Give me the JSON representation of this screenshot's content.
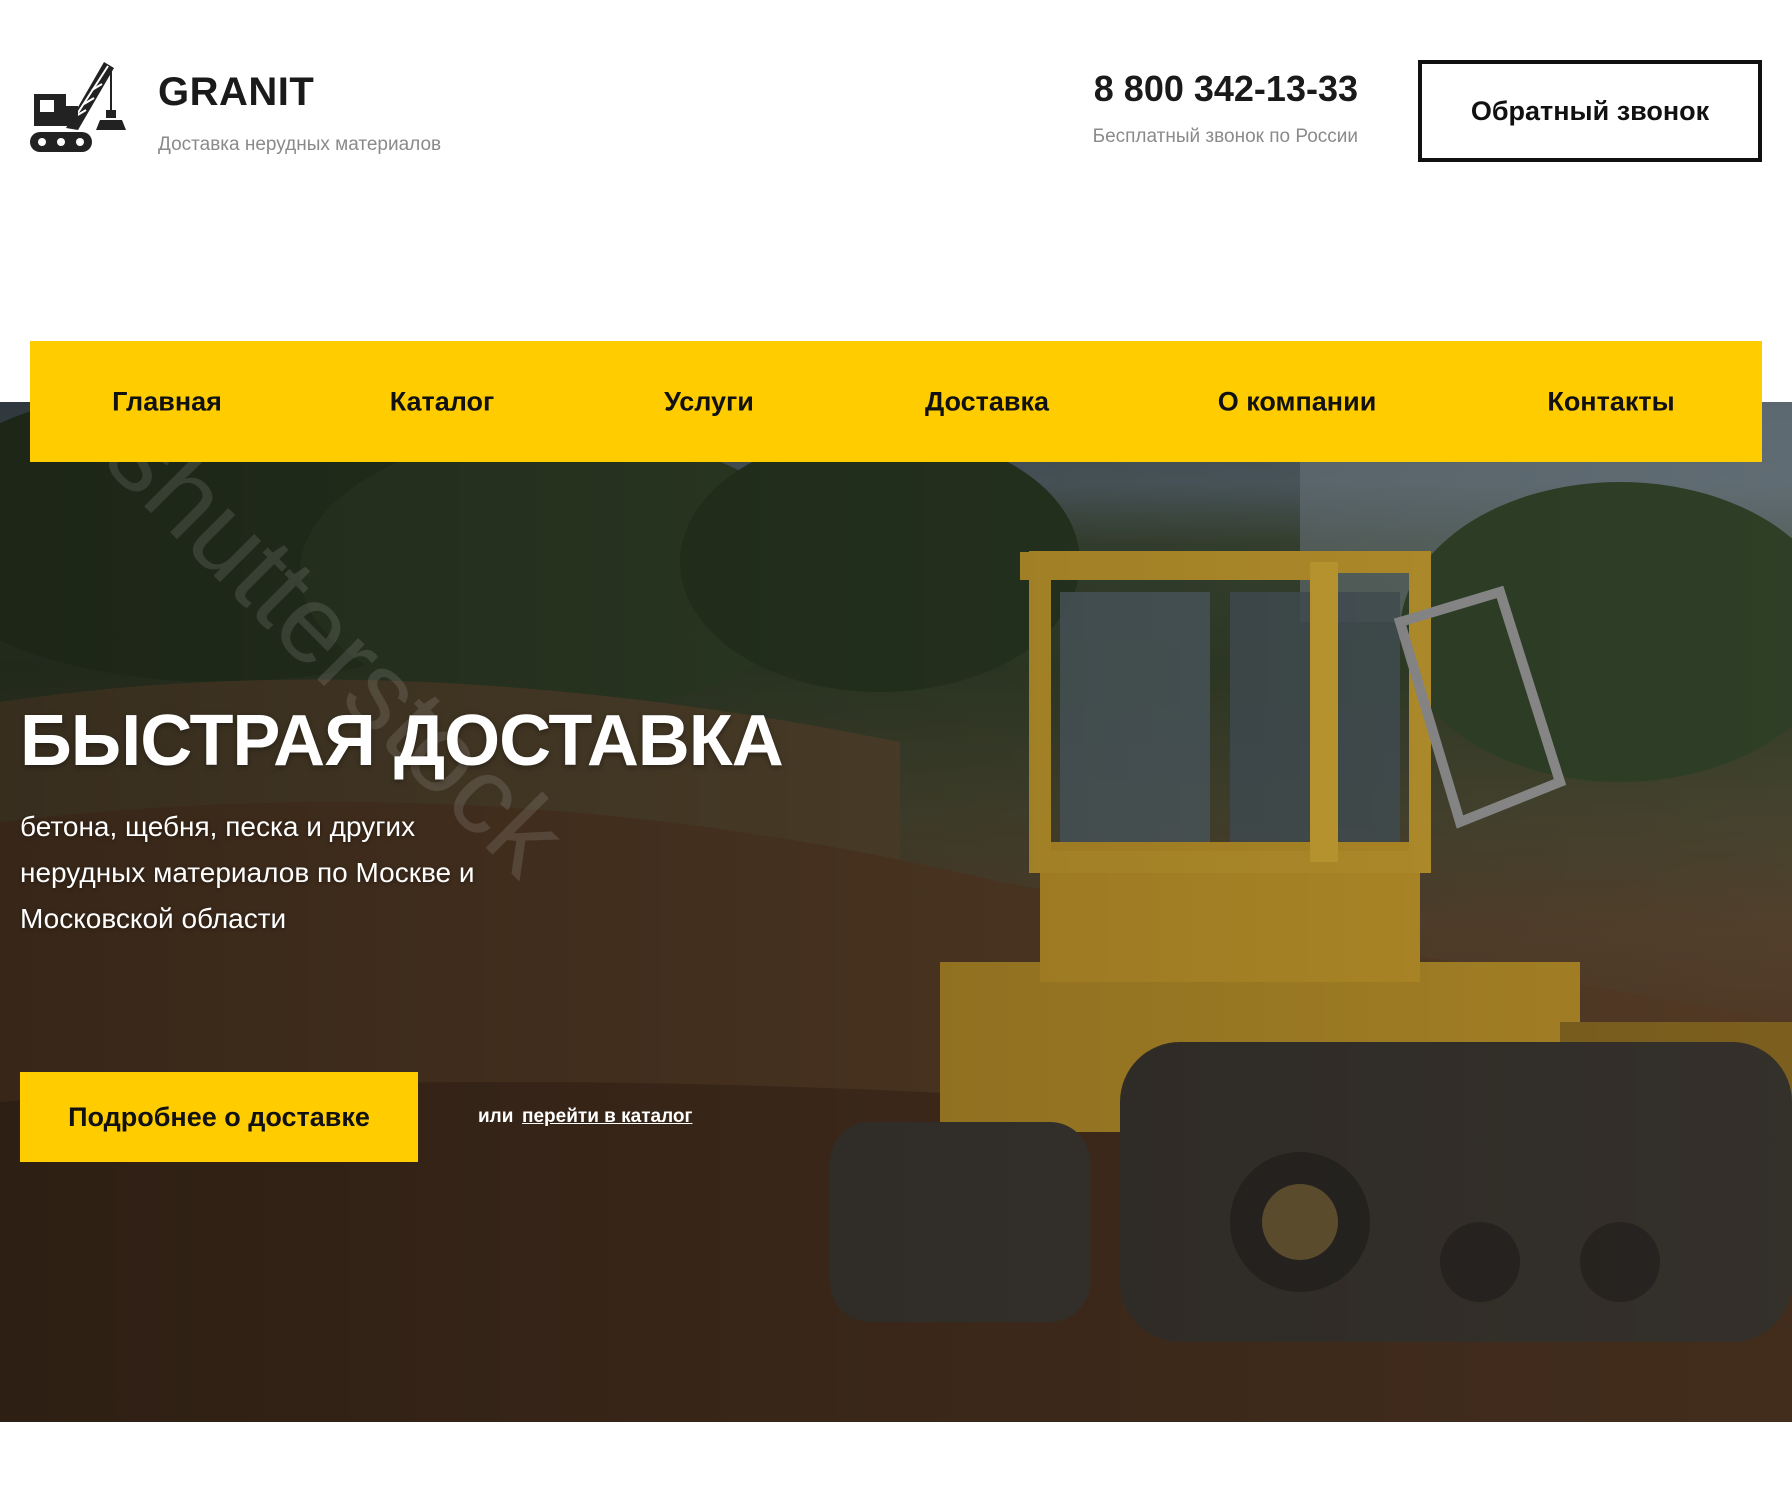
{
  "brand": {
    "name": "GRANIT",
    "tagline": "Доставка нерудных материалов",
    "logo_icon": "crawler-crane-icon"
  },
  "contact": {
    "phone": "8 800 342-13-33",
    "phone_note": "Бесплатный звонок по России",
    "callback_label": "Обратный звонок"
  },
  "nav": {
    "items": [
      {
        "label": "Главная"
      },
      {
        "label": "Каталог"
      },
      {
        "label": "Услуги"
      },
      {
        "label": "Доставка"
      },
      {
        "label": "О компании"
      },
      {
        "label": "Контакты"
      }
    ]
  },
  "hero": {
    "title": "БЫСТРАЯ ДОСТАВКА",
    "subtitle": "бетона, щебня, песка и других нерудных материалов по Москве и Московской области",
    "cta_label": "Подробнее о доставке",
    "or_text": "или",
    "catalog_link_label": "перейти в каталог",
    "image": "bulldozer-on-dirt-photo"
  },
  "colors": {
    "accent": "#ffcc00",
    "text_dark": "#111111",
    "text_muted": "#8a8a8a"
  }
}
